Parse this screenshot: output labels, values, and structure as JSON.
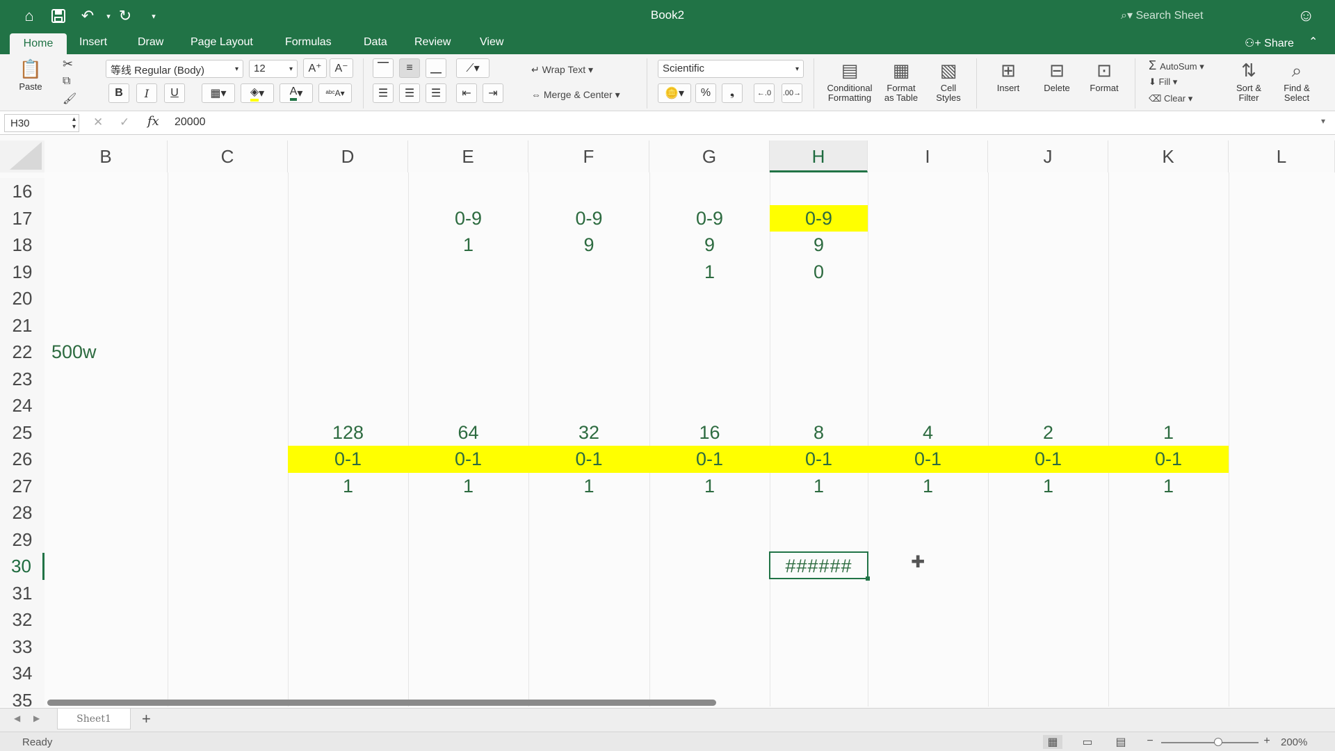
{
  "title_bar": {
    "title": "Book2",
    "search_placeholder": "Search Sheet"
  },
  "tabs": {
    "home": "Home",
    "insert": "Insert",
    "draw": "Draw",
    "page_layout": "Page Layout",
    "formulas": "Formulas",
    "data": "Data",
    "review": "Review",
    "view": "View",
    "share": "Share"
  },
  "ribbon": {
    "paste": "Paste",
    "font_name": "等线 Regular (Body)",
    "font_size": "12",
    "wrap_text": "Wrap Text",
    "merge_center": "Merge & Center",
    "number_format": "Scientific",
    "percent": "%",
    "conditional_formatting_1": "Conditional",
    "conditional_formatting_2": "Formatting",
    "format_as_table_1": "Format",
    "format_as_table_2": "as Table",
    "cell_styles_1": "Cell",
    "cell_styles_2": "Styles",
    "insert": "Insert",
    "delete": "Delete",
    "format": "Format",
    "autosum": "AutoSum",
    "fill": "Fill",
    "clear": "Clear",
    "sort_filter_1": "Sort &",
    "sort_filter_2": "Filter",
    "find_select_1": "Find &",
    "find_select_2": "Select"
  },
  "formula_bar": {
    "name_box": "H30",
    "fx": "fx",
    "value": "20000"
  },
  "columns": [
    "B",
    "C",
    "D",
    "E",
    "F",
    "G",
    "H",
    "I",
    "J",
    "K",
    "L"
  ],
  "selected_column": "H",
  "rows": [
    "16",
    "17",
    "18",
    "19",
    "20",
    "21",
    "22",
    "23",
    "24",
    "25",
    "26",
    "27",
    "28",
    "29",
    "30",
    "31",
    "32",
    "33",
    "34",
    "35"
  ],
  "selected_row": "30",
  "cells": {
    "E17": "0-9",
    "F17": "0-9",
    "G17": "0-9",
    "H17": "0-9",
    "E18": "1",
    "F18": "9",
    "G18": "9",
    "H18": "9",
    "G19": "1",
    "H19": "0",
    "B22": "500w",
    "D25": "128",
    "E25": "64",
    "F25": "32",
    "G25": "16",
    "H25": "8",
    "I25": "4",
    "J25": "2",
    "K25": "1",
    "D26": "0-1",
    "E26": "0-1",
    "F26": "0-1",
    "G26": "0-1",
    "H26": "0-1",
    "I26": "0-1",
    "J26": "0-1",
    "K26": "0-1",
    "D27": "1",
    "E27": "1",
    "F27": "1",
    "G27": "1",
    "H27": "1",
    "I27": "1",
    "J27": "1",
    "K27": "1",
    "H30": "######"
  },
  "highlight_color": "#ffff00",
  "accent_color": "#217346",
  "sheet_tabs": [
    "Sheet1"
  ],
  "status": {
    "ready": "Ready",
    "zoom": "200%"
  }
}
